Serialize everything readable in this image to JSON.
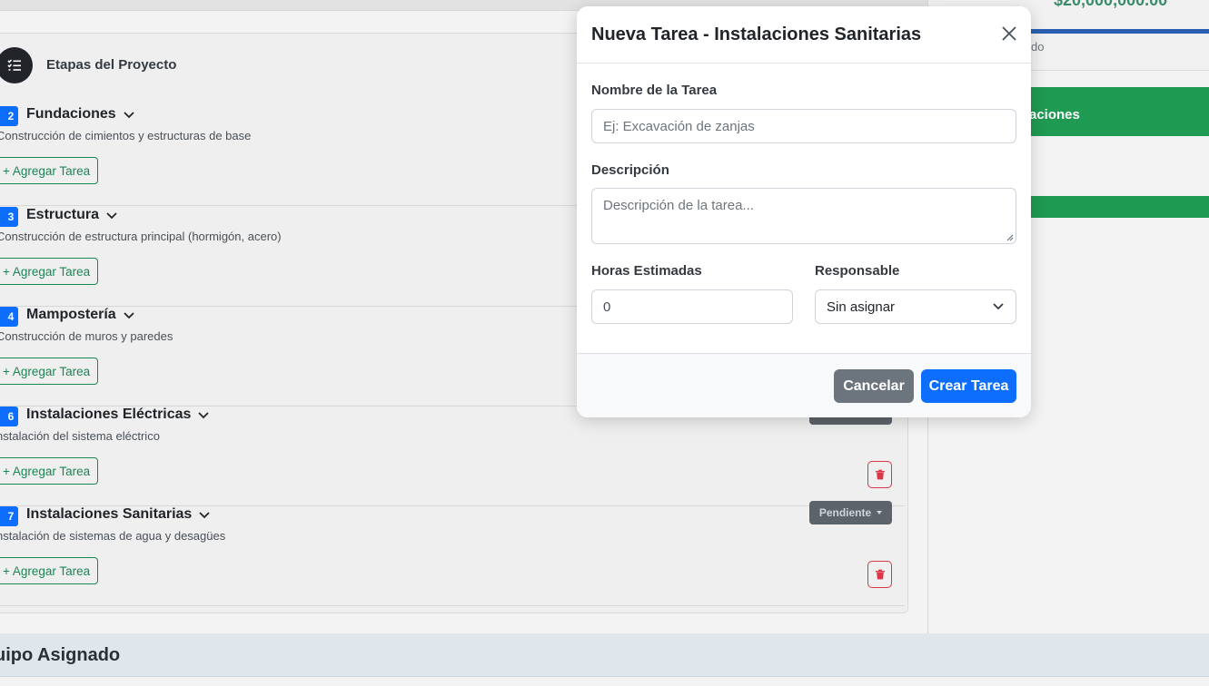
{
  "background": {
    "budget_value": "$20,000,000.00",
    "right_small_label": "do",
    "green_header_label": "aciones",
    "stages_title": "Etapas del Proyecto",
    "add_task_label": "+ Agregar Tarea",
    "status_label": "Pendiente",
    "team_title": "uipo Asignado",
    "stages": [
      {
        "number": "2",
        "name": "Fundaciones",
        "description": "Construcción de cimientos y estructuras de base"
      },
      {
        "number": "3",
        "name": "Estructura",
        "description": "Construcción de estructura principal (hormigón, acero)"
      },
      {
        "number": "4",
        "name": "Mampostería",
        "description": "Construcción de muros y paredes"
      },
      {
        "number": "6",
        "name": "Instalaciones Eléctricas",
        "description": "nstalación del sistema eléctrico"
      },
      {
        "number": "7",
        "name": "Instalaciones Sanitarias",
        "description": "nstalación de sistemas de agua y desagües"
      }
    ]
  },
  "modal": {
    "title": "Nueva Tarea - Instalaciones Sanitarias",
    "task_name_label": "Nombre de la Tarea",
    "task_name_placeholder": "Ej: Excavación de zanjas",
    "description_label": "Descripción",
    "description_placeholder": "Descripción de la tarea...",
    "hours_label": "Horas Estimadas",
    "hours_value": "0",
    "responsible_label": "Responsable",
    "responsible_value": "Sin asignar",
    "cancel_label": "Cancelar",
    "create_label": "Crear Tarea"
  },
  "colors": {
    "primary": "#0d6efd",
    "success": "#198754",
    "danger": "#dc3545",
    "secondary": "#6c757d"
  }
}
